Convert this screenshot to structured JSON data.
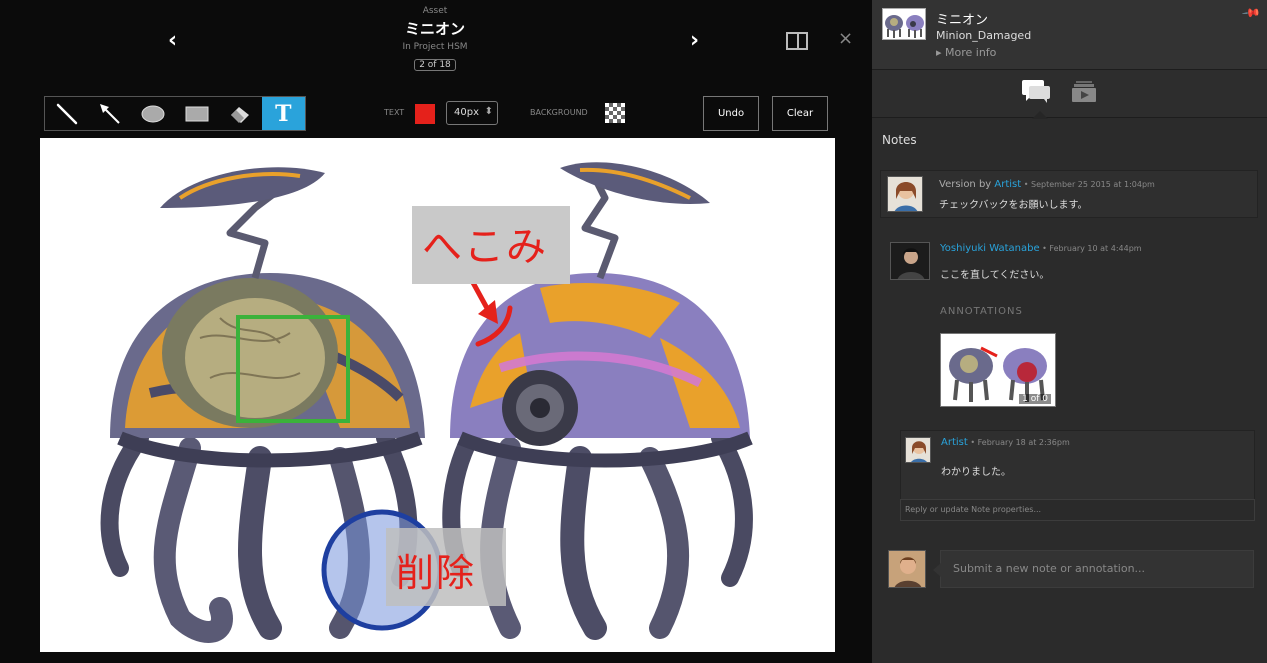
{
  "header": {
    "asset_type": "Asset",
    "title": "ミニオン",
    "project": "In Project HSM",
    "counter": "2 of 18",
    "prev_glyph": "‹",
    "next_glyph": "›",
    "close_glyph": "×"
  },
  "toolbar": {
    "tools": [
      "pen-icon",
      "arrow-icon",
      "ellipse-icon",
      "rectangle-icon",
      "eraser-icon",
      "text-icon"
    ],
    "active_tool": "text-icon",
    "text_tool_glyph": "T",
    "text_label": "TEXT",
    "text_color": "#e5211b",
    "font_size": "40px",
    "background_label": "BACKGROUND",
    "undo_label": "Undo",
    "clear_label": "Clear"
  },
  "canvas": {
    "annotations": {
      "dent_text": "へこみ",
      "delete_text": "削除"
    },
    "colors": {
      "annotation_red": "#e5211b",
      "annotation_green": "#3bb23b",
      "annotation_blue": "#1e3fa0"
    }
  },
  "panel": {
    "asset_info": {
      "title": "ミニオン",
      "name": "Minion_Damaged",
      "more_info": "▸ More info",
      "pin_glyph": "📌"
    },
    "tabs": [
      "notes-icon",
      "versions-icon"
    ],
    "notes_heading": "Notes",
    "notes": [
      {
        "prefix": "Version by ",
        "author": "Artist",
        "date": " • September 25 2015 at 1:04pm",
        "body": "チェックバックをお願いします。"
      },
      {
        "author": "Yoshiyuki Watanabe",
        "date": " • February 10 at 4:44pm",
        "body": "ここを直してください。",
        "annotations_label": "ANNOTATIONS",
        "annotation_count": "1 of 0"
      },
      {
        "author": "Artist",
        "date": " • February 18 at 2:36pm",
        "body": "わかりました。"
      }
    ],
    "reply_placeholder": "Reply or update Note properties...",
    "submit_placeholder": "Submit a new note or annotation..."
  },
  "accent_color": "#2aa3db"
}
